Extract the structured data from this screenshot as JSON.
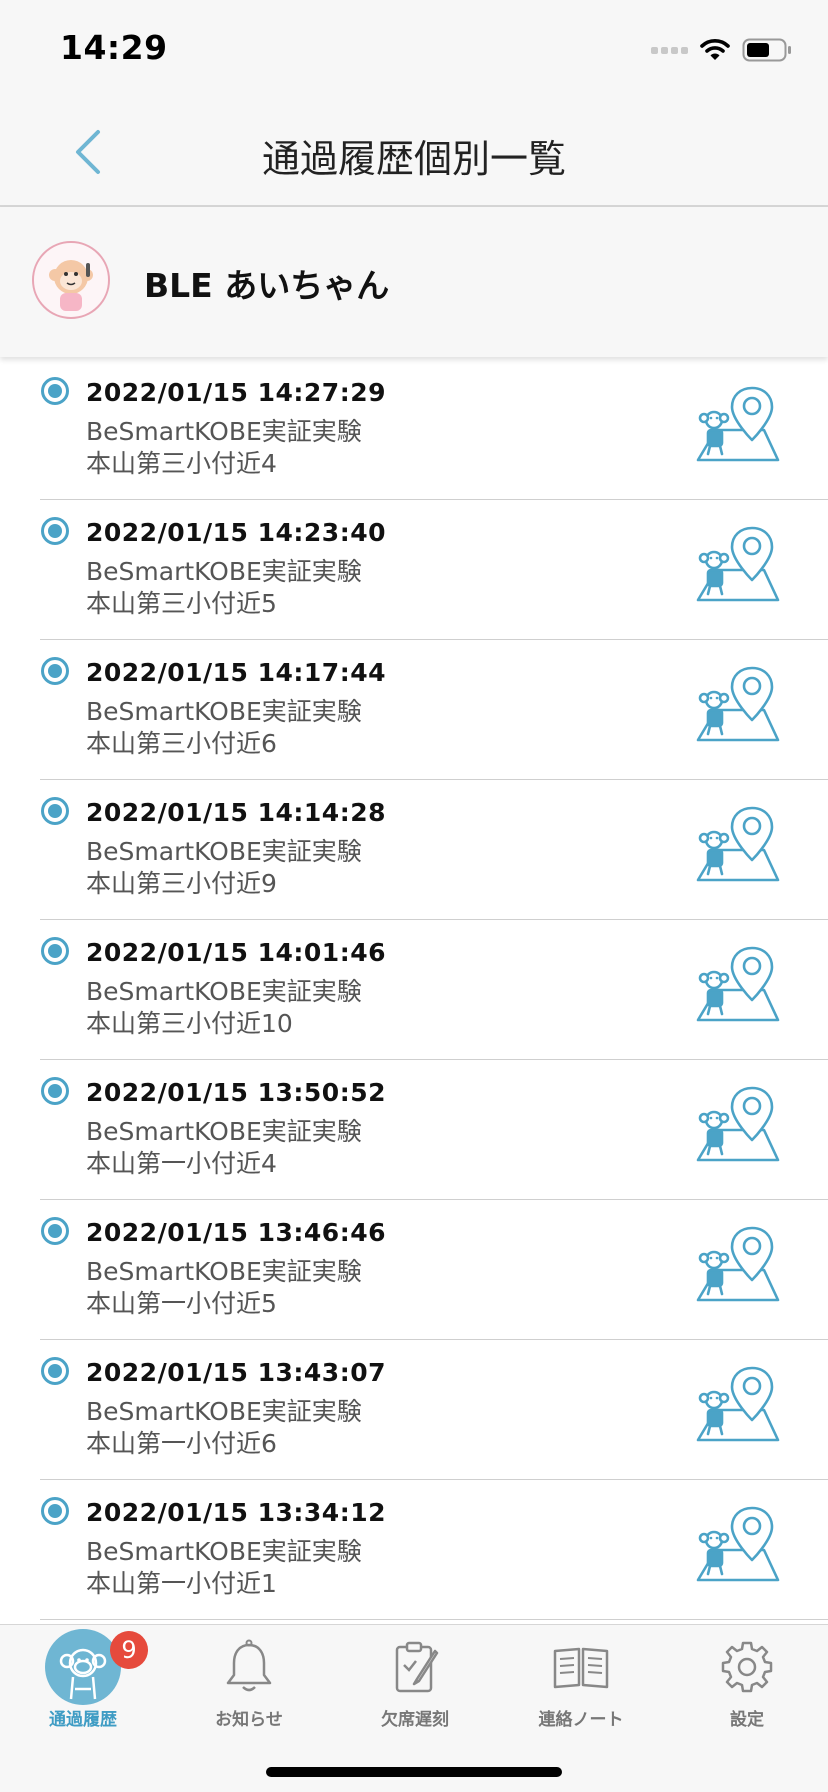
{
  "status_bar": {
    "time": "14:29"
  },
  "header": {
    "title": "通過履歴個別一覧"
  },
  "profile": {
    "name": "BLE あいちゃん"
  },
  "colors": {
    "accent": "#4ba3c7",
    "badge": "#e64a3c",
    "background": "#f7f7f7"
  },
  "history": [
    {
      "time": "2022/01/15 14:27:29",
      "organization": "BeSmartKOBE実証実験",
      "place": "本山第三小付近4"
    },
    {
      "time": "2022/01/15 14:23:40",
      "organization": "BeSmartKOBE実証実験",
      "place": "本山第三小付近5"
    },
    {
      "time": "2022/01/15 14:17:44",
      "organization": "BeSmartKOBE実証実験",
      "place": "本山第三小付近6"
    },
    {
      "time": "2022/01/15 14:14:28",
      "organization": "BeSmartKOBE実証実験",
      "place": "本山第三小付近9"
    },
    {
      "time": "2022/01/15 14:01:46",
      "organization": "BeSmartKOBE実証実験",
      "place": "本山第三小付近10"
    },
    {
      "time": "2022/01/15 13:50:52",
      "organization": "BeSmartKOBE実証実験",
      "place": "本山第一小付近4"
    },
    {
      "time": "2022/01/15 13:46:46",
      "organization": "BeSmartKOBE実証実験",
      "place": "本山第一小付近5"
    },
    {
      "time": "2022/01/15 13:43:07",
      "organization": "BeSmartKOBE実証実験",
      "place": "本山第一小付近6"
    },
    {
      "time": "2022/01/15 13:34:12",
      "organization": "BeSmartKOBE実証実験",
      "place": "本山第一小付近1"
    }
  ],
  "tabs": [
    {
      "label": "通過履歴",
      "icon": "monkey-icon",
      "active": true,
      "badge": "9"
    },
    {
      "label": "お知らせ",
      "icon": "bell-icon"
    },
    {
      "label": "欠席遅刻",
      "icon": "clipboard-pen-icon"
    },
    {
      "label": "連絡ノート",
      "icon": "notebook-icon"
    },
    {
      "label": "設定",
      "icon": "gear-icon"
    }
  ]
}
